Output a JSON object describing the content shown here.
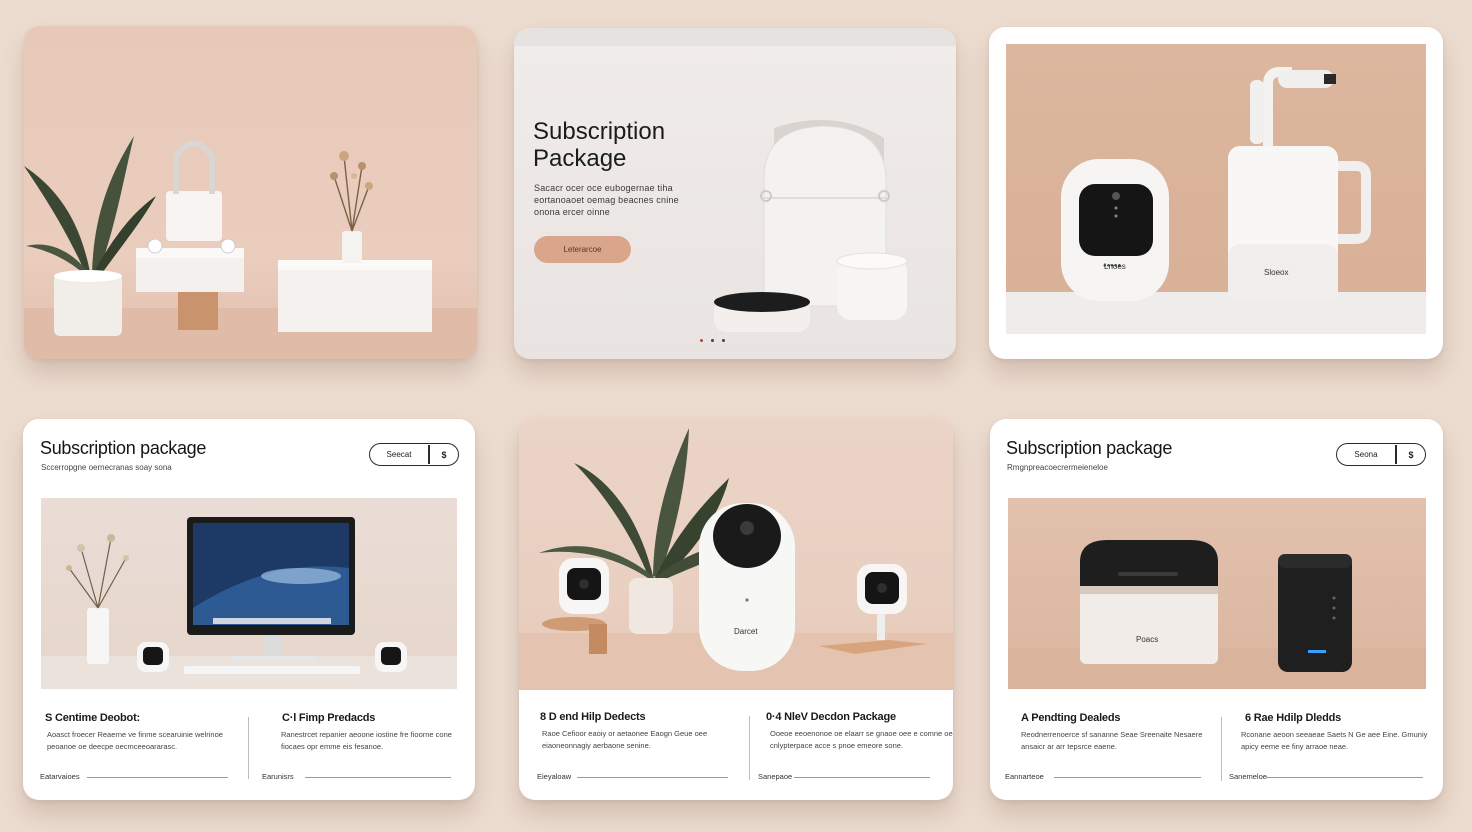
{
  "colors": {
    "page_background": "#ecdcd0",
    "accent_button": "#d9a68c",
    "dark_text": "#1a1a1a"
  },
  "card2": {
    "title_line1": "Subscription",
    "title_line2": "Package",
    "desc_line1": "Sacacr ocer oce eubogernae tiha",
    "desc_line2": "eortanoaoet oemag beacnes cnine",
    "desc_line3": "onona ercer oinne",
    "button_label": "Leterarcoe",
    "carousel_dots": 3
  },
  "card3": {
    "device_label_left": "Lnoes",
    "device_label_right": "Sloeox"
  },
  "card4": {
    "title": "Subscription package",
    "subtitle": "Sccerropgne oernecranas soay sona",
    "toggle_label": "Seecat",
    "toggle_symbol": "$",
    "col1": {
      "title": "S Centime Deobot:",
      "desc": "Aoasct froecer Reaerne ve finme scearuinie welrinoe peoanoe oe deecpe oecmceeoararasc.",
      "footer": "Eatarvaioes"
    },
    "col2": {
      "title": "C·l Fimp Predacds",
      "desc": "Ranestrcet repanier aeoone iostine fre fioorne cone fiocaes opr emme eis fesanoe.",
      "footer": "Earunisrs"
    }
  },
  "card5": {
    "device_label": "Darcet",
    "col1": {
      "title": "8 D end Hilp Dedects",
      "desc": "Raoe Cefioor eaoiy or aetaonee Eaogn Geue oee eiaoneonnagiy aerbaone senine.",
      "footer": "Eieyaloaw"
    },
    "col2": {
      "title": "0·4 NleV Decdon Package",
      "desc": "Ooeoe eeoenonoe oe elaarr se gnaoe oee e comne oeo cnlypterpace acce s pnoe emeore sone.",
      "footer": "Sanepaoe"
    }
  },
  "card6": {
    "title": "Subscription package",
    "subtitle": "Rmgnpreacoecrermeieneloe",
    "toggle_label": "Seona",
    "toggle_symbol": "$",
    "device_label": "Poacs",
    "col1": {
      "title": "A  Pendting Dealeds",
      "desc": "Reodnerrenoerce sf sananne Seae Sreenaite Nesaere ansaicr ar arr tepsrce eaene.",
      "footer": "Eannarteoe"
    },
    "col2": {
      "title": "6 Rae Hdilp Dledds",
      "desc": "Rconane aeoon seeaeae Saets N Ge aee Eine. Gmuniy apicy eeme ee finy arraoe neae.",
      "footer": "Sanemeloe"
    }
  }
}
